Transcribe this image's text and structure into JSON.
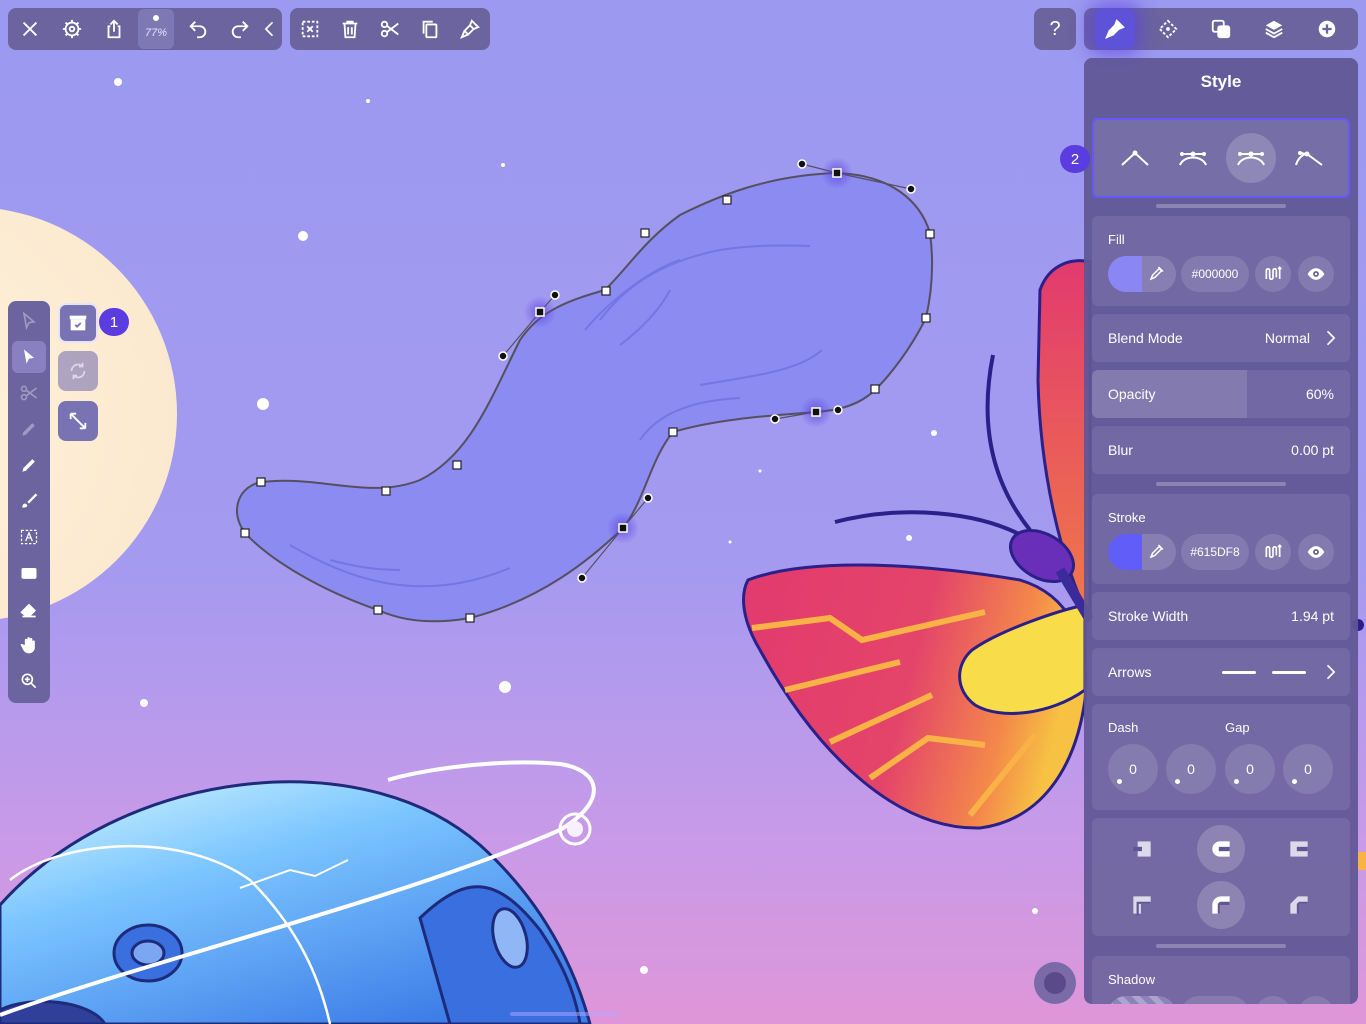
{
  "toolbar_left": {
    "zoom_label": "77%"
  },
  "help_label": "?",
  "panel": {
    "title": "Style",
    "node_badge": "2",
    "fill": {
      "label": "Fill",
      "hex": "#000000",
      "color": "#8a87f5"
    },
    "blend_mode": {
      "label": "Blend Mode",
      "value": "Normal"
    },
    "opacity": {
      "label": "Opacity",
      "value": "60%",
      "level": 0.6
    },
    "blur": {
      "label": "Blur",
      "value": "0.00 pt"
    },
    "stroke": {
      "label": "Stroke",
      "hex": "#615DF8",
      "color": "#615DF8"
    },
    "stroke_width": {
      "label": "Stroke Width",
      "value": "1.94 pt"
    },
    "arrows": {
      "label": "Arrows"
    },
    "dash": {
      "label": "Dash",
      "values": [
        "0",
        "0"
      ]
    },
    "gap": {
      "label": "Gap",
      "values": [
        "0",
        "0"
      ]
    },
    "shadow": {
      "label": "Shadow"
    }
  },
  "sub_badge": "1",
  "colors": {
    "accent": "#5a3ce0",
    "toolbar": "#6b649e",
    "panel": "#605694"
  }
}
